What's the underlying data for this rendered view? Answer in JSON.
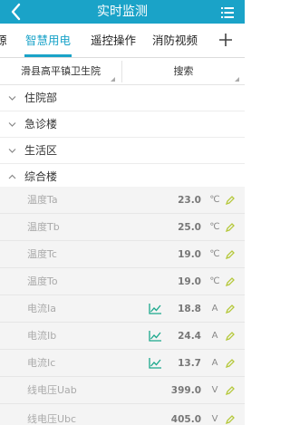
{
  "header": {
    "title": "实时监测"
  },
  "tabs": [
    {
      "label": "源"
    },
    {
      "label": "智慧用电"
    },
    {
      "label": "遥控操作"
    },
    {
      "label": "消防视频"
    }
  ],
  "filter": {
    "location": "滑县高平镇卫生院",
    "search_label": "搜索"
  },
  "groups": [
    {
      "label": "住院部",
      "expanded": false
    },
    {
      "label": "急诊楼",
      "expanded": false
    },
    {
      "label": "生活区",
      "expanded": false
    },
    {
      "label": "综合楼",
      "expanded": true
    }
  ],
  "readings": [
    {
      "name": "温度Ta",
      "value": "23.0",
      "unit": "℃",
      "trend": false
    },
    {
      "name": "温度Tb",
      "value": "25.0",
      "unit": "℃",
      "trend": false
    },
    {
      "name": "温度Tc",
      "value": "19.0",
      "unit": "℃",
      "trend": false
    },
    {
      "name": "温度To",
      "value": "19.0",
      "unit": "℃",
      "trend": false
    },
    {
      "name": "电流Ia",
      "value": "18.8",
      "unit": "A",
      "trend": true
    },
    {
      "name": "电流Ib",
      "value": "24.4",
      "unit": "A",
      "trend": true
    },
    {
      "name": "电流Ic",
      "value": "13.7",
      "unit": "A",
      "trend": true
    },
    {
      "name": "线电压Uab",
      "value": "399.0",
      "unit": "V",
      "trend": false
    },
    {
      "name": "线电压Ubc",
      "value": "405.0",
      "unit": "V",
      "trend": false
    }
  ],
  "colors": {
    "primary": "#1aa3c8",
    "trend": "#1aa88c",
    "edit": "#b5c83a"
  },
  "icons": {
    "back": "chevron-left-icon",
    "menu": "list-menu-icon",
    "add": "plus-icon",
    "expand": "chevron-down-icon",
    "collapse": "chevron-up-icon",
    "trend": "line-chart-icon",
    "edit": "pencil-icon"
  }
}
